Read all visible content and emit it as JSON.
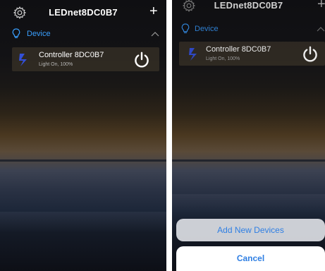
{
  "screens": [
    {
      "header": {
        "title": "LEDnet8DC0B7",
        "settings_icon": "gear-icon",
        "add_icon": "plus-icon",
        "add_label": "+"
      },
      "group": {
        "label": "Device",
        "icon": "bulb-icon",
        "toggle_icon": "chevron-up-icon"
      },
      "device": {
        "name": "Controller 8DC0B7",
        "status": "Light On, 100%",
        "icon": "zengge-logo-icon",
        "power_icon": "power-icon"
      }
    },
    {
      "header": {
        "title": "LEDnet8DC0B7",
        "settings_icon": "gear-icon",
        "add_icon": "plus-icon",
        "add_label": "+"
      },
      "group": {
        "label": "Device",
        "icon": "bulb-icon",
        "toggle_icon": "chevron-up-icon"
      },
      "device": {
        "name": "Controller 8DC0B7",
        "status": "Light On, 100%",
        "icon": "zengge-logo-icon",
        "power_icon": "power-icon"
      },
      "action_sheet": {
        "add_label": "Add New Devices",
        "cancel_label": "Cancel"
      }
    }
  ],
  "colors": {
    "accent": "#3aa0ff",
    "action_text": "#2f7fe3",
    "title_text": "#ffffff",
    "status_text": "#b8b8b8"
  }
}
